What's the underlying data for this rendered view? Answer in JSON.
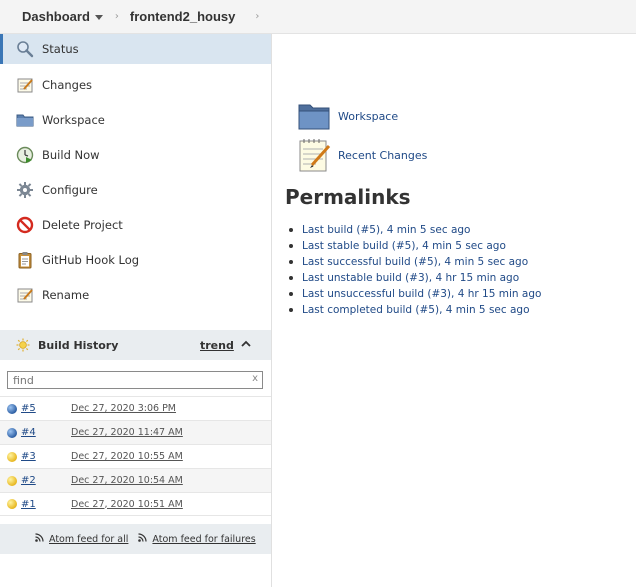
{
  "breadcrumb": {
    "dashboard": "Dashboard",
    "project": "frontend2_housy"
  },
  "sidebar": {
    "items": [
      {
        "label": "Status",
        "icon": "magnifier-icon"
      },
      {
        "label": "Changes",
        "icon": "notepad-icon"
      },
      {
        "label": "Workspace",
        "icon": "folder-icon"
      },
      {
        "label": "Build Now",
        "icon": "clock-play-icon"
      },
      {
        "label": "Configure",
        "icon": "gear-icon"
      },
      {
        "label": "Delete Project",
        "icon": "no-entry-icon"
      },
      {
        "label": "GitHub Hook Log",
        "icon": "clipboard-icon"
      },
      {
        "label": "Rename",
        "icon": "notepad-icon"
      }
    ]
  },
  "build_history": {
    "title": "Build History",
    "trend": "trend",
    "search_value": "find",
    "clear": "x",
    "builds": [
      {
        "num": "#5",
        "date": "Dec 27, 2020 3:06 PM",
        "status": "blue"
      },
      {
        "num": "#4",
        "date": "Dec 27, 2020 11:47 AM",
        "status": "blue"
      },
      {
        "num": "#3",
        "date": "Dec 27, 2020 10:55 AM",
        "status": "yellow"
      },
      {
        "num": "#2",
        "date": "Dec 27, 2020 10:54 AM",
        "status": "yellow"
      },
      {
        "num": "#1",
        "date": "Dec 27, 2020 10:51 AM",
        "status": "yellow"
      }
    ],
    "feed_all": "Atom feed for all",
    "feed_failures": "Atom feed for failures"
  },
  "main": {
    "workspace_link": "Workspace",
    "recent_changes_link": "Recent Changes",
    "permalinks_title": "Permalinks",
    "permalinks": [
      {
        "label": "Last build (#5)",
        "time": "4 min 5 sec ago"
      },
      {
        "label": "Last stable build (#5)",
        "time": "4 min 5 sec ago"
      },
      {
        "label": "Last successful build (#5)",
        "time": "4 min 5 sec ago"
      },
      {
        "label": "Last unstable build (#3)",
        "time": "4 hr 15 min ago"
      },
      {
        "label": "Last unsuccessful build (#3)",
        "time": "4 hr 15 min ago"
      },
      {
        "label": "Last completed build (#5)",
        "time": "4 min 5 sec ago"
      }
    ]
  },
  "colors": {
    "link": "#204a87",
    "active_item_bg": "#d9e5f0",
    "panel_bg": "#e9edf0"
  }
}
